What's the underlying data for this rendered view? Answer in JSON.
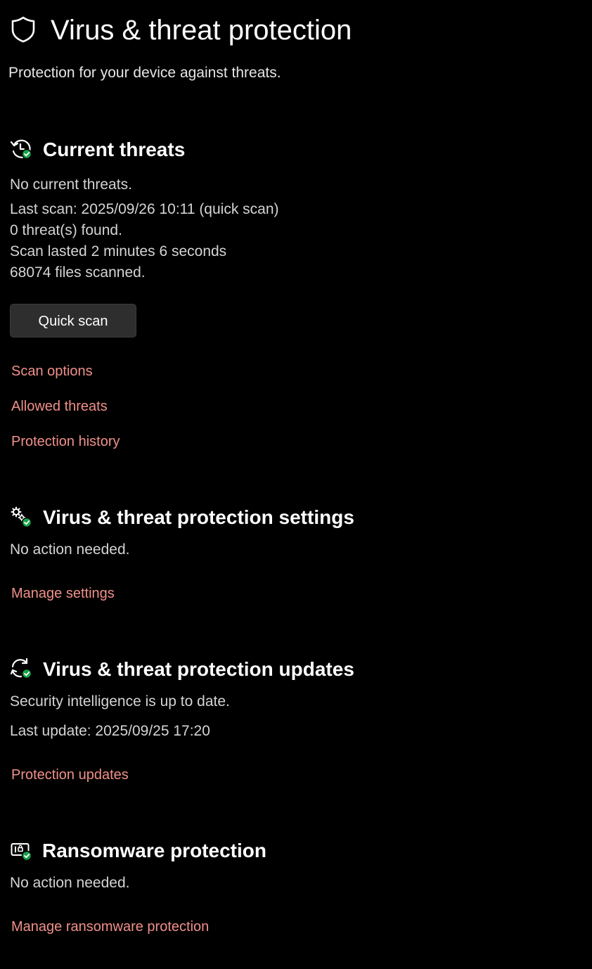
{
  "header": {
    "title": "Virus & threat protection",
    "subtitle": "Protection for your device against threats.",
    "icon": "shield-icon"
  },
  "current_threats": {
    "icon": "history-check-icon",
    "title": "Current threats",
    "lines": [
      "No current threats.",
      "Last scan: 2025/09/26 10:11 (quick scan)",
      "0 threat(s) found.",
      "Scan lasted 2 minutes 6 seconds",
      "68074 files scanned."
    ],
    "quick_scan_label": "Quick scan",
    "links": [
      "Scan options",
      "Allowed threats",
      "Protection history"
    ]
  },
  "settings": {
    "icon": "gears-check-icon",
    "title": "Virus & threat protection settings",
    "status": "No action needed.",
    "link": "Manage settings"
  },
  "updates": {
    "icon": "refresh-check-icon",
    "title": "Virus & threat protection updates",
    "status": "Security intelligence is up to date.",
    "last_update": "Last update: 2025/09/25 17:20",
    "link": "Protection updates"
  },
  "ransomware": {
    "icon": "ransomware-check-icon",
    "title": "Ransomware protection",
    "status": "No action needed.",
    "link": "Manage ransomware protection"
  },
  "colors": {
    "background": "#000000",
    "link": "#f0908a",
    "ok_badge": "#16a34a",
    "button": "#2e2e2e"
  }
}
